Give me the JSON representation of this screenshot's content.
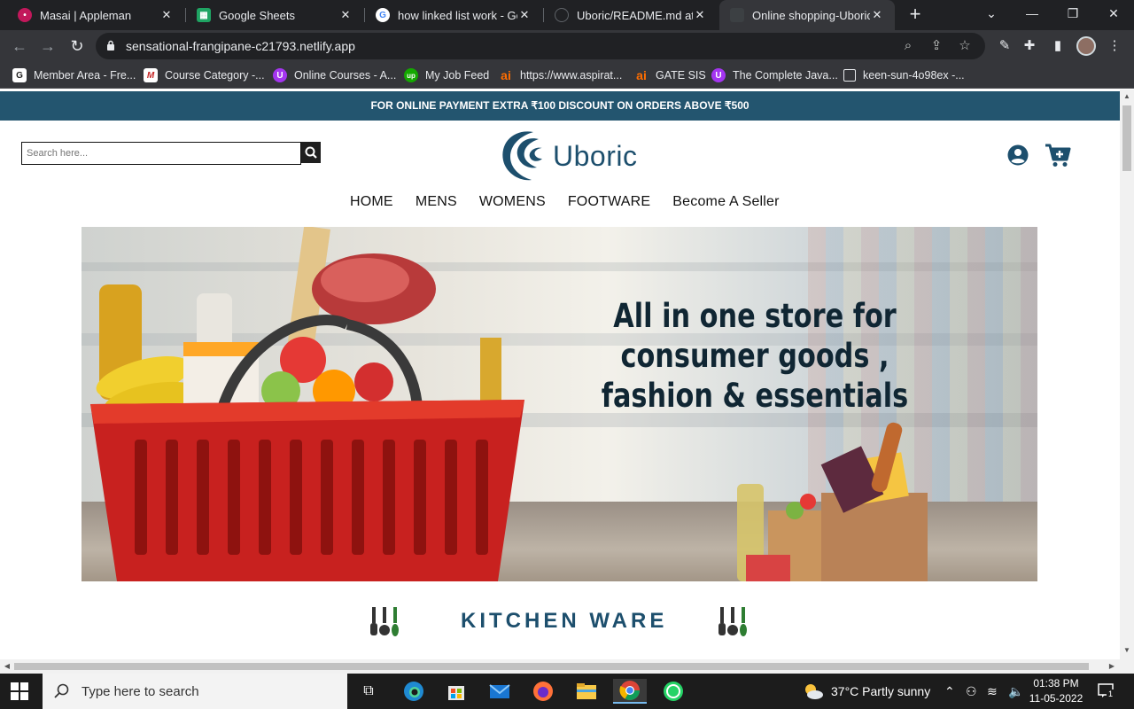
{
  "browser": {
    "tabs": [
      {
        "title": "Masai | Appleman",
        "icon": "masai-icon"
      },
      {
        "title": "Google Sheets",
        "icon": "google-sheets-icon"
      },
      {
        "title": "how linked list work - Goo",
        "icon": "google-icon"
      },
      {
        "title": "Uboric/README.md at m",
        "icon": "github-icon"
      },
      {
        "title": "Online shopping-Uboric",
        "icon": "uboric-icon",
        "active": true
      }
    ],
    "url": "sensational-frangipane-c21793.netlify.app",
    "bookmarks": [
      {
        "label": "Member Area - Fre...",
        "icon": "g-icon"
      },
      {
        "label": "Course Category -...",
        "icon": "course-icon"
      },
      {
        "label": "Online Courses - A...",
        "icon": "online-courses-icon"
      },
      {
        "label": "My Job Feed",
        "icon": "upwork-icon"
      },
      {
        "label": "https://www.aspirat...",
        "icon": "ai-icon"
      },
      {
        "label": "GATE SIS",
        "icon": "ai-icon"
      },
      {
        "label": "The Complete Java...",
        "icon": "udemy-icon"
      },
      {
        "label": "keen-sun-4o98ex -...",
        "icon": "page-icon"
      }
    ]
  },
  "site": {
    "promo": "FOR ONLINE PAYMENT EXTRA ₹100 DISCOUNT ON ORDERS ABOVE ₹500",
    "search_placeholder": "Search here...",
    "brand": "Uboric",
    "nav": [
      "HOME",
      "MENS",
      "WOMENS",
      "FOOTWARE",
      "Become A Seller"
    ],
    "banner_headline_line1": "All in one store for consumer goods ,",
    "banner_headline_line2": "fashion & essentials",
    "section_title": "KITCHEN WARE",
    "colors": {
      "brand": "#1d4f6d",
      "promo_bar": "#23556f",
      "basket": "#c8211f"
    }
  },
  "taskbar": {
    "search_placeholder": "Type here to search",
    "weather": "37°C  Partly sunny",
    "time": "01:38 PM",
    "date": "11-05-2022",
    "notification_count": "1"
  }
}
